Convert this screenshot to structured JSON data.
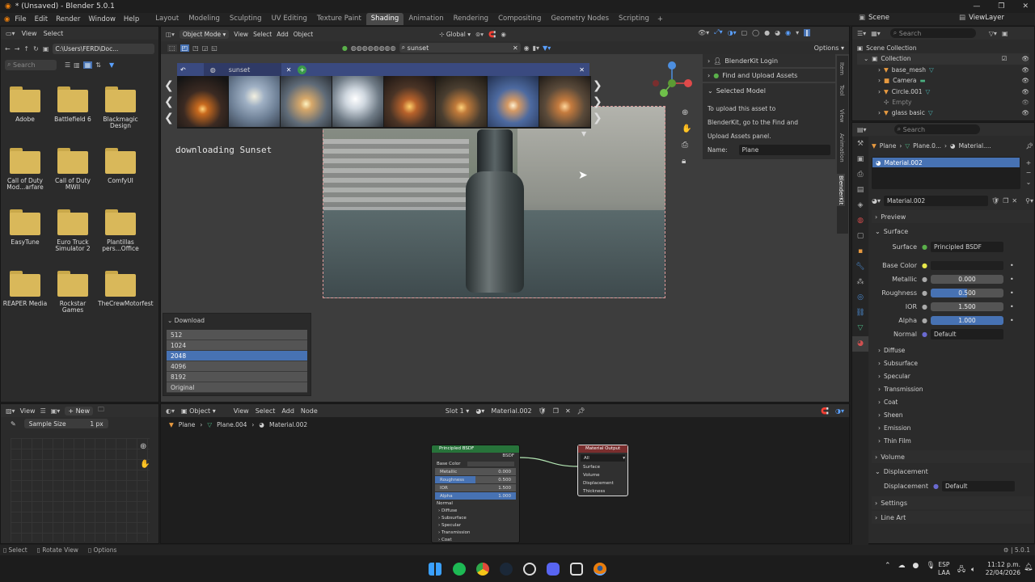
{
  "window": {
    "title": "* (Unsaved) - Blender 5.0.1"
  },
  "menu": [
    "File",
    "Edit",
    "Render",
    "Window",
    "Help"
  ],
  "workspaces": [
    "Layout",
    "Modeling",
    "Sculpting",
    "UV Editing",
    "Texture Paint",
    "Shading",
    "Animation",
    "Rendering",
    "Compositing",
    "Geometry Nodes",
    "Scripting"
  ],
  "active_workspace": "Shading",
  "topright": {
    "scene": "Scene",
    "viewlayer": "ViewLayer"
  },
  "filebrowser": {
    "view": "View",
    "select": "Select",
    "path": "C:\\Users\\FERD\\Doc...",
    "search_placeholder": "Search",
    "folders": [
      "Adobe",
      "Battlefield 6",
      "Blackmagic Design",
      "Call of Duty Mod...arfare",
      "Call of Duty MWII",
      "ComfyUI",
      "EasyTune",
      "Euro Truck Simulator 2",
      "Plantillas pers...Office",
      "REAPER Media",
      "Rockstar Games",
      "TheCrewMotorfest"
    ]
  },
  "viewport": {
    "mode": "Object Mode",
    "view": "View",
    "select": "Select",
    "add": "Add",
    "object": "Object",
    "transform": "Global",
    "search_value": "sunset",
    "options": "Options",
    "status_text": "downloading Sunset",
    "tab_label": "sunset",
    "download": {
      "title": "Download",
      "options": [
        "512",
        "1024",
        "2048",
        "4096",
        "8192",
        "Original"
      ],
      "selected": "2048"
    }
  },
  "blenderkit": {
    "login": "BlenderKit Login",
    "find_upload": "Find and Upload Assets",
    "selected_model": "Selected Model",
    "info": [
      "To upload this asset to",
      "BlenderKit, go to the Find and",
      "Upload Assets panel."
    ],
    "name_label": "Name:",
    "name_value": "Plane",
    "side_tabs": [
      "Item",
      "Tool",
      "View",
      "Animation",
      "BlenderKit"
    ]
  },
  "outliner": {
    "search_placeholder": "Search",
    "root": "Scene Collection",
    "collection": "Collection",
    "items": [
      "base_mesh",
      "Camera",
      "Circle.001",
      "Empty",
      "glass basic"
    ]
  },
  "properties": {
    "search_placeholder": "Search",
    "breadcrumb": [
      "Plane",
      "Plane.0...",
      "Material...."
    ],
    "slot": "Material.002",
    "material": "Material.002",
    "sections": {
      "preview": "Preview",
      "surface": "Surface",
      "volume": "Volume",
      "displacement": "Displacement",
      "settings": "Settings",
      "lineart": "Line Art"
    },
    "surface_label": "Surface",
    "surface_value": "Principled BSDF",
    "base_color": "Base Color",
    "metallic_label": "Metallic",
    "metallic": "0.000",
    "roughness_label": "Roughness",
    "roughness": "0.500",
    "ior_label": "IOR",
    "ior": "1.500",
    "alpha_label": "Alpha",
    "alpha": "1.000",
    "normal_label": "Normal",
    "normal_value": "Default",
    "subsections": [
      "Diffuse",
      "Subsurface",
      "Specular",
      "Transmission",
      "Coat",
      "Sheen",
      "Emission",
      "Thin Film"
    ],
    "displacement_label": "Displacement",
    "displacement_value": "Default",
    "base_color_hex": "#e8e84a"
  },
  "image_editor": {
    "view": "View",
    "new": "New",
    "sample_size_label": "Sample Size",
    "sample_size_value": "1 px"
  },
  "node_editor": {
    "object": "Object",
    "view": "View",
    "select": "Select",
    "add": "Add",
    "node": "Node",
    "slot": "Slot 1",
    "material": "Material.002",
    "breadcrumb": [
      "Plane",
      "Plane.004",
      "Material.002"
    ],
    "bsdf": {
      "title": "Principled BSDF",
      "out": "BSDF",
      "rows": [
        "Base Color",
        "Metallic",
        "Roughness",
        "IOR",
        "Alpha",
        "Normal"
      ],
      "vals": [
        "",
        "0.000",
        "0.500",
        "1.500",
        "1.000",
        ""
      ],
      "subs": [
        "Diffuse",
        "Subsurface",
        "Specular",
        "Transmission",
        "Coat"
      ]
    },
    "output": {
      "title": "Material Output",
      "target": "All",
      "rows": [
        "Surface",
        "Volume",
        "Displacement",
        "Thickness"
      ]
    }
  },
  "statusbar": {
    "select": "Select",
    "rotate": "Rotate View",
    "options": "Options",
    "version": "5.0.1"
  },
  "taskbar": {
    "lang1": "ESP",
    "lang2": "LAA",
    "time": "11:12 p.m.",
    "date": "22/04/2026"
  }
}
